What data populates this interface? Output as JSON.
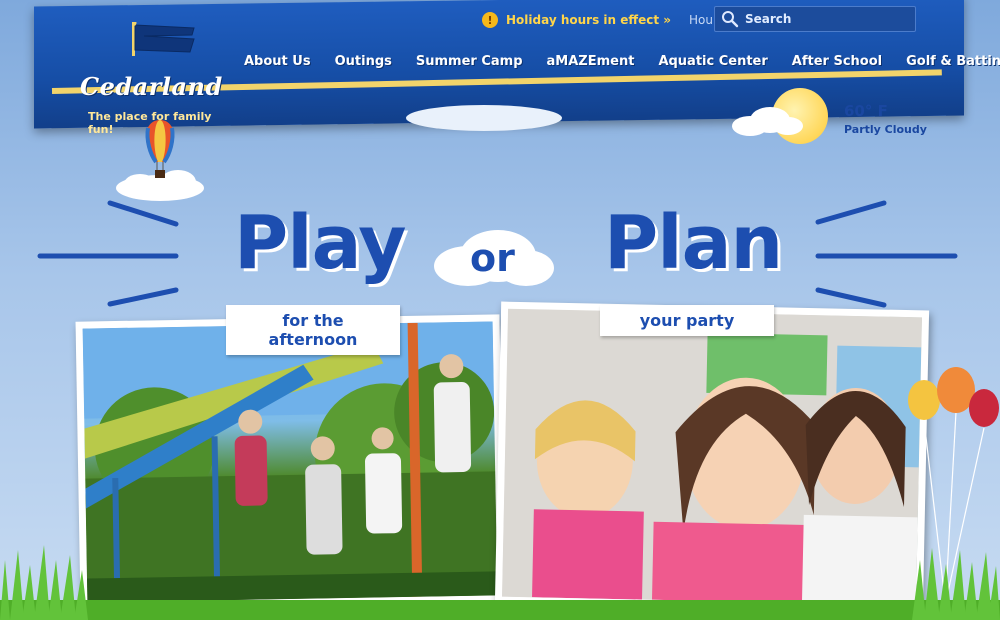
{
  "brand": {
    "name": "Cedarland",
    "tagline": "The place for family fun!"
  },
  "utility": {
    "holiday_icon": "!",
    "holiday_text": "Holiday hours in effect »",
    "hours_link": "Hours"
  },
  "search": {
    "placeholder": "Search"
  },
  "nav": {
    "items": [
      {
        "label": "About Us"
      },
      {
        "label": "Outings"
      },
      {
        "label": "Summer Camp"
      },
      {
        "label": "aMAZEment"
      },
      {
        "label": "Aquatic Center"
      },
      {
        "label": "After School"
      },
      {
        "label": "Golf & Batting"
      }
    ]
  },
  "weather": {
    "temperature": "60° F",
    "condition": "Partly Cloudy"
  },
  "hero": {
    "left_word": "Play",
    "connector": "or",
    "right_word": "Plan",
    "left_caption": "for the afternoon",
    "right_caption": "your party"
  },
  "colors": {
    "header_blue": "#1a55b3",
    "accent_yellow": "#ffd54a",
    "headline_blue": "#1d4eb0",
    "sky": "#a8c6ea",
    "grass": "#5cb82e"
  },
  "icons": {
    "holiday": "alert-icon",
    "search": "search-icon",
    "weather": "partly-cloudy-icon",
    "balloon": "hot-air-balloon-icon"
  }
}
